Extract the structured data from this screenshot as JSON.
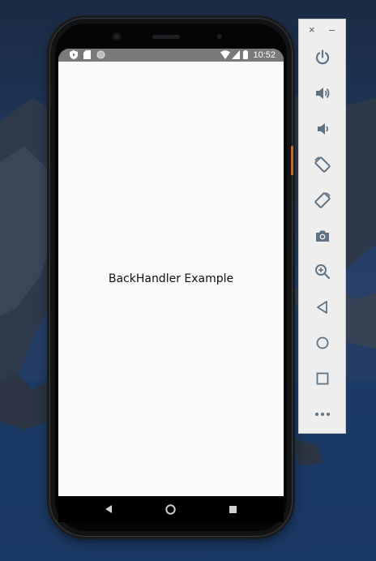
{
  "status_bar": {
    "time": "10:52"
  },
  "app": {
    "title": "BackHandler Example"
  },
  "toolbar": {
    "close_label": "×",
    "minimize_label": "–"
  },
  "colors": {
    "toolbar_icon": "#5f7384",
    "status_bar": "#7a7a7a",
    "screen_bg": "#fafafa",
    "side_button": "#c9691e"
  },
  "icons": {
    "status_left": [
      "play-protect-icon",
      "sd-card-icon",
      "dot-icon"
    ],
    "status_right": [
      "wifi-icon",
      "signal-icon",
      "battery-icon"
    ],
    "nav": [
      "back-icon",
      "home-icon",
      "recents-icon"
    ],
    "toolbar": [
      "power-icon",
      "volume-up-icon",
      "volume-down-icon",
      "rotate-left-icon",
      "rotate-right-icon",
      "camera-icon",
      "zoom-icon",
      "back-icon",
      "home-icon",
      "overview-icon",
      "more-icon"
    ]
  }
}
